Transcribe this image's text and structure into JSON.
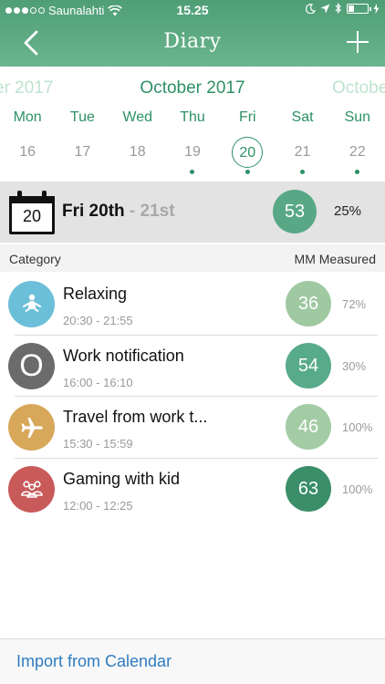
{
  "status": {
    "carrier": "Saunalahti",
    "time": "15.25"
  },
  "nav": {
    "title": "Diary"
  },
  "calendar": {
    "prev_month": "er 2017",
    "current_month": "October 2017",
    "next_month": "Octobe",
    "weekdays": [
      "Mon",
      "Tue",
      "Wed",
      "Thu",
      "Fri",
      "Sat",
      "Sun"
    ],
    "days": [
      {
        "num": "16",
        "has_entries": false,
        "selected": false
      },
      {
        "num": "17",
        "has_entries": false,
        "selected": false
      },
      {
        "num": "18",
        "has_entries": false,
        "selected": false
      },
      {
        "num": "19",
        "has_entries": true,
        "selected": false
      },
      {
        "num": "20",
        "has_entries": true,
        "selected": true
      },
      {
        "num": "21",
        "has_entries": true,
        "selected": false
      },
      {
        "num": "22",
        "has_entries": true,
        "selected": false
      }
    ]
  },
  "summary": {
    "cal_date": "20",
    "title": "Fri 20th",
    "title_dim": "- 21st",
    "score": "53",
    "percent": "25%",
    "score_color": "#58a886"
  },
  "columns": {
    "category": "Category",
    "measured": "MM Measured"
  },
  "entries": [
    {
      "name": "Relaxing",
      "time": "20:30 - 21:55",
      "score": "36",
      "percent": "72%",
      "icon": "meditation-icon",
      "icon_color": "#6cbfd8",
      "score_color": "#9fc9a1"
    },
    {
      "name": "Work notification",
      "time": "16:00 - 16:10",
      "score": "54",
      "percent": "30%",
      "icon": "letter-o-icon",
      "icon_glyph": "O",
      "icon_color": "#6b6b6b",
      "score_color": "#58ab8a"
    },
    {
      "name": "Travel from work t...",
      "time": "15:30 - 15:59",
      "score": "46",
      "percent": "100%",
      "icon": "airplane-icon",
      "icon_color": "#d7a75a",
      "score_color": "#a3cca5"
    },
    {
      "name": "Gaming with kid",
      "time": "12:00 - 12:25",
      "score": "63",
      "percent": "100%",
      "icon": "group-icon",
      "icon_color": "#c95a5a",
      "score_color": "#3a8e68"
    }
  ],
  "footer": {
    "import_label": "Import from Calendar"
  }
}
